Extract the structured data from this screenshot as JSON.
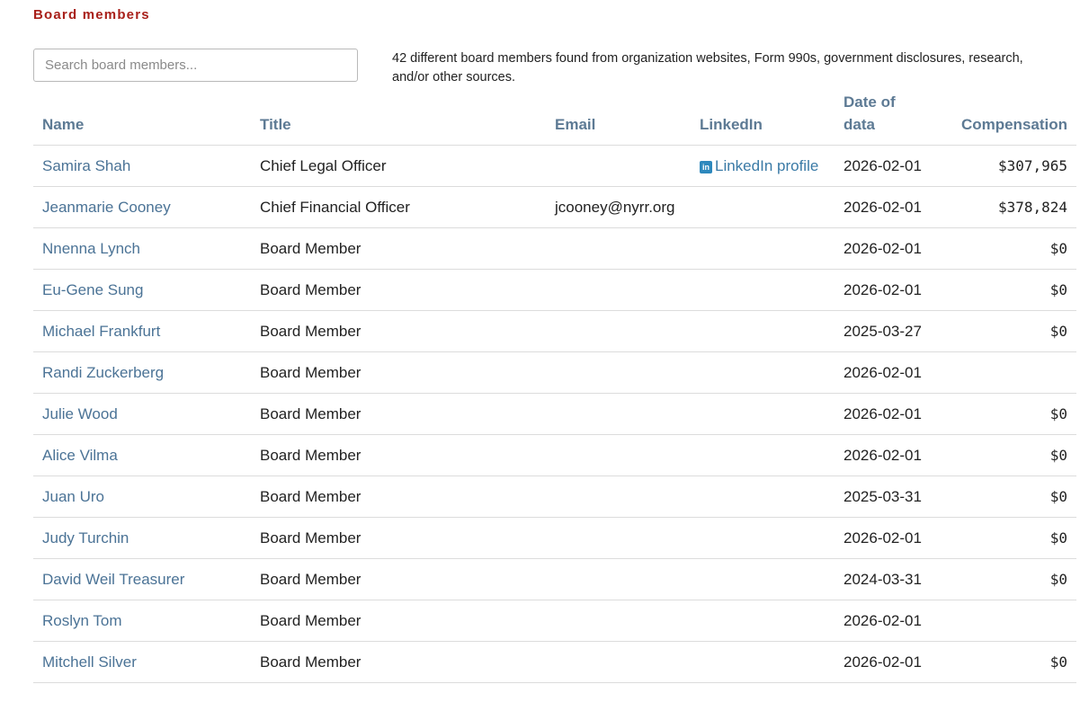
{
  "section_title": "Board members",
  "search": {
    "placeholder": "Search board members..."
  },
  "description": "42 different board members found from organization websites, Form 990s, government disclosures, research, and/or other sources.",
  "table": {
    "headers": {
      "name": "Name",
      "title": "Title",
      "email": "Email",
      "linkedin": "LinkedIn",
      "date_line1": "Date of",
      "date_line2": "data",
      "compensation": "Compensation"
    },
    "rows": [
      {
        "name": "Samira Shah",
        "title": "Chief Legal Officer",
        "email": "",
        "linkedin": "LinkedIn profile",
        "date": "2026-02-01",
        "compensation": "$307,965"
      },
      {
        "name": "Jeanmarie Cooney",
        "title": "Chief Financial Officer",
        "email": "jcooney@nyrr.org",
        "linkedin": "",
        "date": "2026-02-01",
        "compensation": "$378,824"
      },
      {
        "name": "Nnenna Lynch",
        "title": "Board Member",
        "email": "",
        "linkedin": "",
        "date": "2026-02-01",
        "compensation": "$0"
      },
      {
        "name": "Eu-Gene Sung",
        "title": "Board Member",
        "email": "",
        "linkedin": "",
        "date": "2026-02-01",
        "compensation": "$0"
      },
      {
        "name": "Michael Frankfurt",
        "title": "Board Member",
        "email": "",
        "linkedin": "",
        "date": "2025-03-27",
        "compensation": "$0"
      },
      {
        "name": "Randi Zuckerberg",
        "title": "Board Member",
        "email": "",
        "linkedin": "",
        "date": "2026-02-01",
        "compensation": ""
      },
      {
        "name": "Julie Wood",
        "title": "Board Member",
        "email": "",
        "linkedin": "",
        "date": "2026-02-01",
        "compensation": "$0"
      },
      {
        "name": "Alice Vilma",
        "title": "Board Member",
        "email": "",
        "linkedin": "",
        "date": "2026-02-01",
        "compensation": "$0"
      },
      {
        "name": "Juan Uro",
        "title": "Board Member",
        "email": "",
        "linkedin": "",
        "date": "2025-03-31",
        "compensation": "$0"
      },
      {
        "name": "Judy Turchin",
        "title": "Board Member",
        "email": "",
        "linkedin": "",
        "date": "2026-02-01",
        "compensation": "$0"
      },
      {
        "name": "David Weil Treasurer",
        "title": "Board Member",
        "email": "",
        "linkedin": "",
        "date": "2024-03-31",
        "compensation": "$0"
      },
      {
        "name": "Roslyn Tom",
        "title": "Board Member",
        "email": "",
        "linkedin": "",
        "date": "2026-02-01",
        "compensation": ""
      },
      {
        "name": "Mitchell Silver",
        "title": "Board Member",
        "email": "",
        "linkedin": "",
        "date": "2026-02-01",
        "compensation": "$0"
      }
    ]
  },
  "icons": {
    "linkedin": "linkedin-icon"
  },
  "colors": {
    "accent": "#a8201a",
    "link": "#4b7396",
    "header": "#5d7a94",
    "linkedin": "#2d88bd"
  }
}
